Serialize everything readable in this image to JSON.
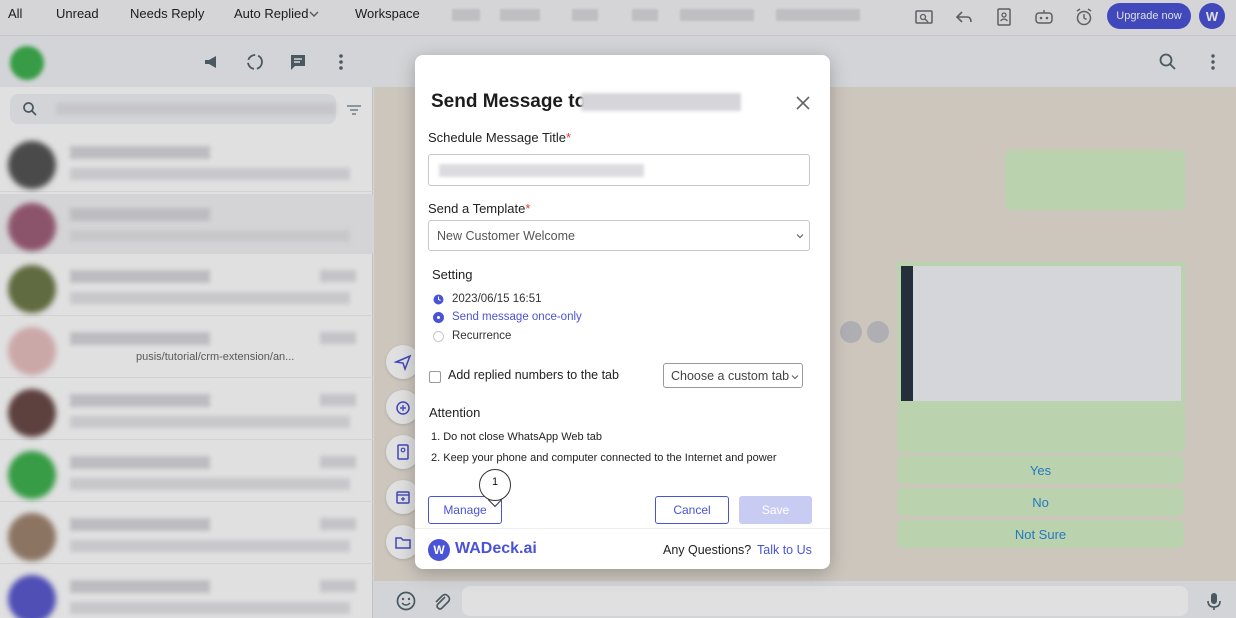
{
  "topbar": {
    "tabs": [
      "All",
      "Unread",
      "Needs Reply",
      "Auto Replied",
      "Workspace"
    ],
    "upgrade_label": "Upgrade now",
    "logo_letter": "W"
  },
  "chat_list": {
    "snippet": "pusis/tutorial/crm-extension/an..."
  },
  "chat_area": {
    "quick_replies": [
      "Yes",
      "No",
      "Not Sure"
    ]
  },
  "modal": {
    "title": "Send Message to:",
    "title_field_label": "Schedule Message Title",
    "template_label": "Send a Template",
    "template_value": "New Customer Welcome",
    "required_mark": "*",
    "setting_label": "Setting",
    "datetime": "2023/06/15 16:51",
    "option_once": "Send message once-only",
    "option_recurrence": "Recurrence",
    "add_replied_label": "Add replied numbers to the tab",
    "custom_tab_placeholder": "Choose a custom tab",
    "attention_label": "Attention",
    "attention_items": [
      "1. Do not close WhatsApp Web tab",
      "2. Keep your phone and computer connected to the Internet and power"
    ],
    "manage_label": "Manage",
    "cancel_label": "Cancel",
    "save_label": "Save",
    "step_marker": "1",
    "brand": "WADeck.ai",
    "brand_logo_letter": "W",
    "questions_text": "Any Questions?",
    "talk_link": "Talk to Us"
  },
  "colors": {
    "accent": "#4a53d6",
    "required": "#e53935",
    "quick_reply_text": "#2b8ad8",
    "bubble": "#d5f0c8"
  }
}
